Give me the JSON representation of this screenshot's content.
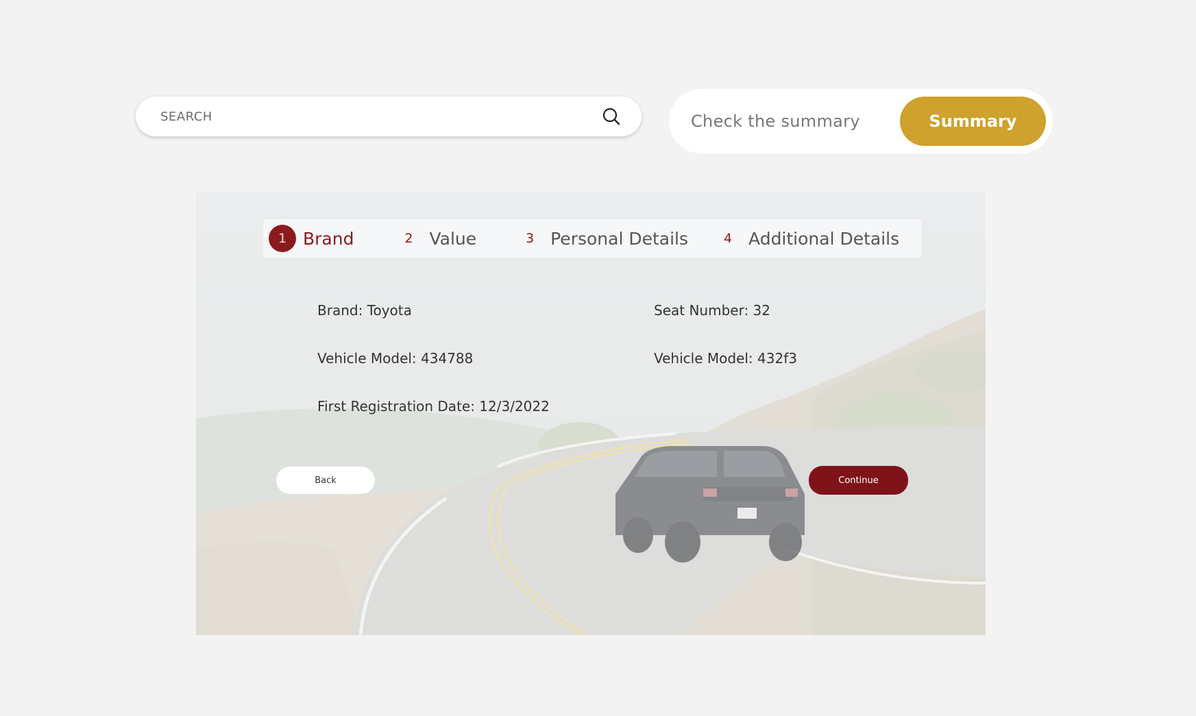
{
  "search": {
    "placeholder": "SEARCH"
  },
  "summary": {
    "prompt": "Check the summary",
    "button_label": "Summary"
  },
  "stepper": {
    "steps": [
      {
        "number": "1",
        "label": "Brand",
        "active": true
      },
      {
        "number": "2",
        "label": "Value",
        "active": false
      },
      {
        "number": "3",
        "label": "Personal Details",
        "active": false
      },
      {
        "number": "4",
        "label": "Additional Details",
        "active": false
      }
    ]
  },
  "details": {
    "brand": "Brand: Toyota",
    "vehicle_model_1": "Vehicle Model: 434788",
    "first_registration": "First Registration Date: 12/3/2022",
    "seat_number": "Seat Number: 32",
    "vehicle_model_2": "Vehicle Model: 432f3"
  },
  "actions": {
    "back_label": "Back",
    "continue_label": "Continue"
  },
  "colors": {
    "accent": "#8b1a1f",
    "gold": "#cfa12d",
    "background": "#f3f3f3"
  },
  "icons": {
    "search": "search-icon"
  }
}
